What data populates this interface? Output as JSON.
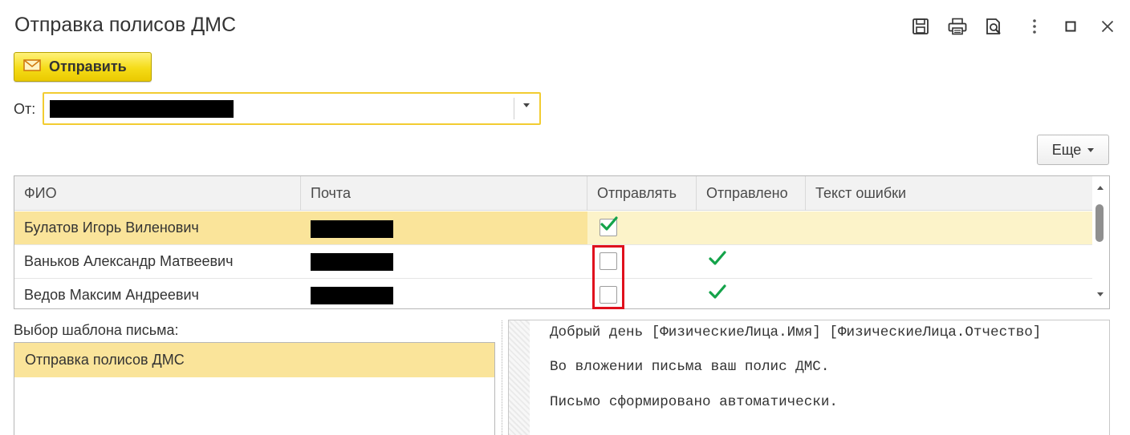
{
  "window": {
    "title": "Отправка полисов ДМС",
    "toolbar_icons": [
      "save-icon",
      "print-icon",
      "preview-icon",
      "more-vertical-icon",
      "maximize-icon",
      "close-icon"
    ]
  },
  "actions": {
    "send_label": "Отправить",
    "send_icon": "envelope-icon"
  },
  "from": {
    "label": "От:",
    "value_redacted": true
  },
  "more_button": {
    "label": "Еще"
  },
  "recipients_table": {
    "columns": [
      "ФИО",
      "Почта",
      "Отправлять",
      "Отправлено",
      "Текст ошибки"
    ],
    "rows": [
      {
        "fio": "Булатов Игорь Виленович",
        "email_redacted": true,
        "send": true,
        "sent": false,
        "error": "",
        "selected": true
      },
      {
        "fio": "Ваньков Александр Матвеевич",
        "email_redacted": true,
        "send": false,
        "sent": true,
        "error": "",
        "selected": false
      },
      {
        "fio": "Ведов Максим Андреевич",
        "email_redacted": true,
        "send": false,
        "sent": true,
        "error": "",
        "selected": false
      }
    ]
  },
  "template": {
    "label": "Выбор шаблона письма:",
    "items": [
      "Отправка полисов ДМС"
    ],
    "selected": "Отправка полисов ДМС"
  },
  "message_body": {
    "lines": [
      "Добрый день [ФизическиеЛица.Имя] [ФизическиеЛица.Отчество]",
      "Во вложении письма ваш полис ДМС.",
      "Письмо сформировано автоматически."
    ]
  },
  "colors": {
    "accent_yellow": "#f5dc18",
    "selection_row": "#fcf3c9",
    "selection_cell": "#fae49a",
    "check_green": "#14a34a",
    "highlight_red": "#e0101d",
    "field_focus_border": "#f2cc31"
  }
}
